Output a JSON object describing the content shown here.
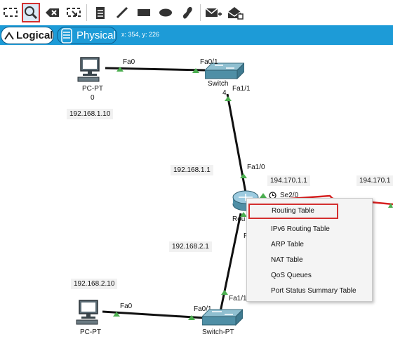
{
  "toolbar": {
    "items": [
      {
        "icon": "select-icon"
      },
      {
        "icon": "inspect-icon",
        "active": true
      },
      {
        "icon": "delete-icon"
      },
      {
        "icon": "resize-icon"
      },
      {
        "icon": "note-icon"
      },
      {
        "icon": "line-icon"
      },
      {
        "icon": "rectangle-icon"
      },
      {
        "icon": "ellipse-icon"
      },
      {
        "icon": "freeform-icon"
      },
      {
        "icon": "add-simple-pdu-icon"
      },
      {
        "icon": "add-complex-pdu-icon"
      }
    ],
    "active_color": "#d32f2f"
  },
  "modebar": {
    "logical_label": "Logical",
    "physical_label": "Physical",
    "coords": "x: 354, y: 226",
    "bar_color": "#1d9bd7"
  },
  "devices": {
    "pc0_type": "PC-PT",
    "pc0_num": "0",
    "switch0_label": "Switch",
    "switch0_num": "4",
    "router_label": "Rou",
    "router_extra": "F",
    "switch1_label": "Switch-PT",
    "pc1_type": "PC-PT"
  },
  "ports": {
    "pc0_fa0": "Fa0",
    "sw0_fa01": "Fa0/1",
    "sw0_fa11": "Fa1/1",
    "r_fa10": "Fa1/0",
    "r_se20": "Se2/0",
    "sw1_fa11": "Fa1/1",
    "sw1_fa01": "Fa0/1",
    "pc1_fa0": "Fa0"
  },
  "ips": {
    "pc0": "192.168.1.10",
    "gw1": "192.168.1.1",
    "serial": "194.170.1.1",
    "serial_peer": "194.170.1",
    "gw2": "192.168.2.1",
    "pc1": "192.168.2.10"
  },
  "context_menu": {
    "items": [
      "Routing Table",
      "IPv6 Routing Table",
      "ARP Table",
      "NAT Table",
      "QoS Queues",
      "Port Status Summary Table"
    ],
    "highlighted": "Routing Table"
  },
  "colors": {
    "link": "#111111",
    "serial_link": "#d62020",
    "port_up": "#4caf50"
  }
}
